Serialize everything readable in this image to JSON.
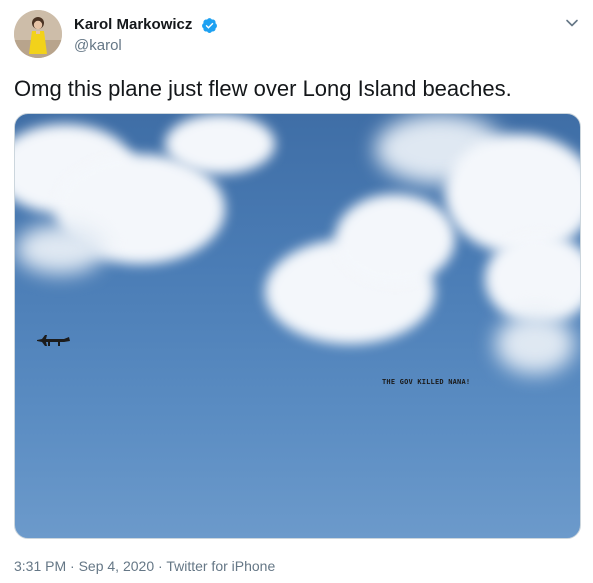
{
  "author": {
    "display_name": "Karol Markowicz",
    "handle": "@karol",
    "verified": true
  },
  "tweet": {
    "text": "Omg this plane just flew over Long Island beaches."
  },
  "media": {
    "banner_text": "THE GOV KILLED NANA!"
  },
  "meta": {
    "time": "3:31 PM",
    "separator1": " · ",
    "date": "Sep 4, 2020",
    "separator2": " · ",
    "source": "Twitter for iPhone"
  },
  "icons": {
    "verified": "verified-badge-icon",
    "menu": "chevron-down-icon"
  },
  "colors": {
    "verified_blue": "#1da1f2",
    "secondary_text": "#657786"
  }
}
